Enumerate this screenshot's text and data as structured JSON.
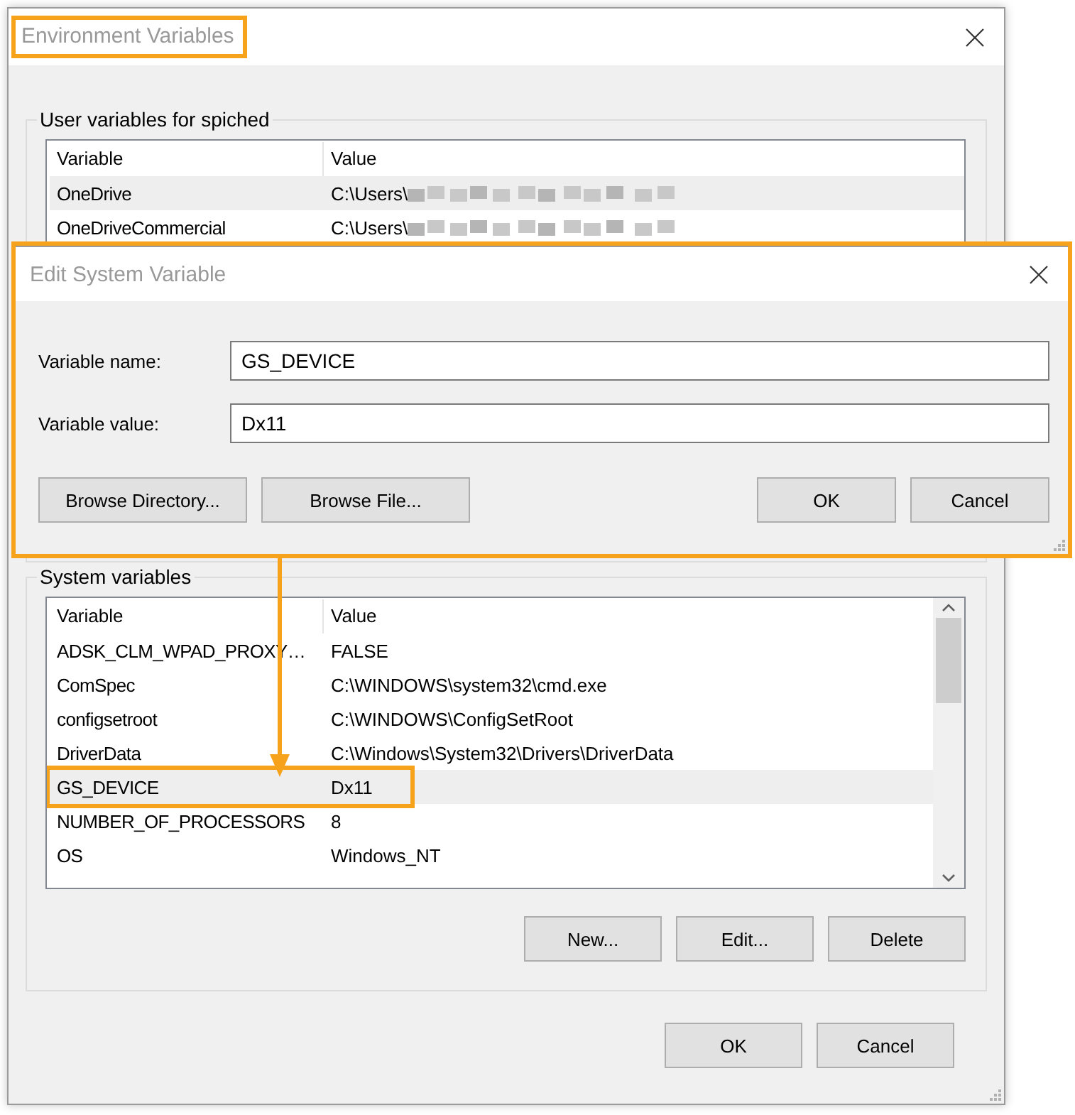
{
  "environment_window": {
    "title": "Environment Variables",
    "title_highlighted": true,
    "user_group": {
      "label": "User variables for spiched",
      "columns": [
        "Variable",
        "Value"
      ],
      "rows": [
        {
          "variable": "OneDrive",
          "value": "C:\\Users\\",
          "selected": true
        },
        {
          "variable": "OneDriveCommercial",
          "value": "C:\\Users\\",
          "selected": false
        }
      ]
    },
    "system_group": {
      "label": "System variables",
      "columns": [
        "Variable",
        "Value"
      ],
      "rows": [
        {
          "variable": "ADSK_CLM_WPAD_PROXY…",
          "value": "FALSE",
          "selected": false,
          "highlighted": false
        },
        {
          "variable": "ComSpec",
          "value": "C:\\WINDOWS\\system32\\cmd.exe",
          "selected": false,
          "highlighted": false
        },
        {
          "variable": "configsetroot",
          "value": "C:\\WINDOWS\\ConfigSetRoot",
          "selected": false,
          "highlighted": false
        },
        {
          "variable": "DriverData",
          "value": "C:\\Windows\\System32\\Drivers\\DriverData",
          "selected": false,
          "highlighted": false
        },
        {
          "variable": "GS_DEVICE",
          "value": "Dx11",
          "selected": true,
          "highlighted": true
        },
        {
          "variable": "NUMBER_OF_PROCESSORS",
          "value": "8",
          "selected": false,
          "highlighted": false
        },
        {
          "variable": "OS",
          "value": "Windows_NT",
          "selected": false,
          "highlighted": false
        }
      ],
      "buttons": [
        "New...",
        "Edit...",
        "Delete"
      ]
    },
    "buttons": [
      "OK",
      "Cancel"
    ]
  },
  "edit_dialog": {
    "title": "Edit System Variable",
    "highlighted": true,
    "fields": [
      {
        "label": "Variable name:",
        "value": "GS_DEVICE"
      },
      {
        "label": "Variable value:",
        "value": "Dx11"
      }
    ],
    "left_buttons": [
      "Browse Directory...",
      "Browse File..."
    ],
    "right_buttons": [
      "OK",
      "Cancel"
    ]
  }
}
